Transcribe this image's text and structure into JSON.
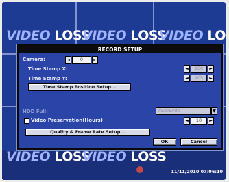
{
  "tiles": [
    {
      "prefix": "VIDEO",
      "word": "LOSS"
    },
    {
      "prefix": "VIDEO",
      "word": "LOSS"
    },
    {
      "prefix": "VIDEO",
      "word": "LOSS"
    },
    {
      "prefix": "VIDEO",
      "word": "LOSS"
    },
    {
      "prefix": "VIDEO",
      "word": "LOSS"
    }
  ],
  "dialog": {
    "title": "RECORD SETUP",
    "camera_label": "Camera:",
    "camera_value": "0",
    "ts_x_label": "Time Stamp X:",
    "ts_x_value": "160",
    "ts_y_label": "Time Stamp Y:",
    "ts_y_value": "205",
    "ts_position_button": "Time Stamp Position Setup...",
    "hdd_full_label": "HDD Full:",
    "hdd_full_value": "Overwrite",
    "video_preservation_label": "Video Preservation(Hours)",
    "video_preservation_value": "10",
    "quality_button": "Quality & Frame Rate Setup...",
    "ok_button": "OK",
    "cancel_button": "Cancel"
  },
  "status": {
    "timestamp": "11/11/2010 07:06:10"
  },
  "icons": {
    "left_arrow": "◄",
    "right_arrow": "►",
    "dropdown": "▼"
  },
  "colors": {
    "background": "#1e3b94",
    "dialog": "#2b44a8",
    "titlebar": "#0c0c0c"
  }
}
